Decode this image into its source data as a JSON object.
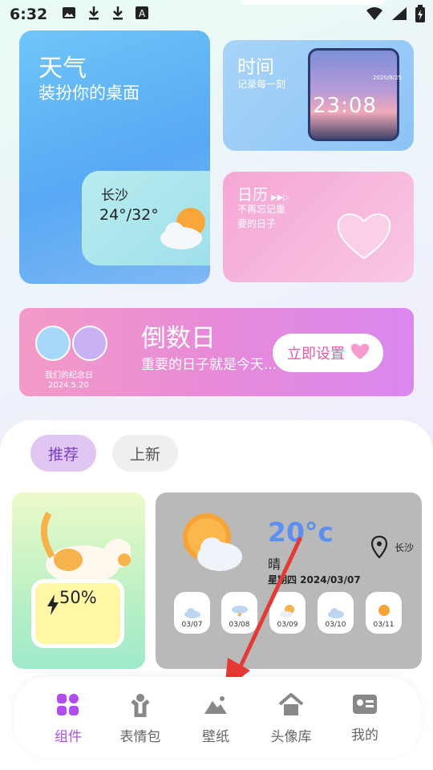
{
  "status_bar": {
    "time": "6:32"
  },
  "weather_card": {
    "title": "天气",
    "subtitle": "装扮你的桌面",
    "city": "长沙",
    "temp_range": "24°/32°"
  },
  "time_card": {
    "title": "时间",
    "subtitle": "记录每一刻",
    "clock": "23:08",
    "photo_date": "2020/8/25"
  },
  "calendar_card": {
    "title": "日历",
    "line1": "不再忘记重",
    "line2": "要的日子"
  },
  "countdown": {
    "title": "倒数日",
    "subtitle": "重要的日子就是今天...",
    "button": "立即设置",
    "caption": "我们的纪念日",
    "date": "2024.5.20"
  },
  "tabs": [
    {
      "label": "推荐"
    },
    {
      "label": "上新"
    }
  ],
  "battery_widget": {
    "percent": "50%",
    "level": 0.5
  },
  "weather_widget": {
    "temperature": "20°c",
    "condition": "晴",
    "date_line": "星期四 2024/03/07",
    "city": "长沙",
    "forecast": [
      {
        "date": "03/07",
        "icon": "cloud-icon"
      },
      {
        "date": "03/08",
        "icon": "thunder-icon"
      },
      {
        "date": "03/09",
        "icon": "sun-cloud-icon"
      },
      {
        "date": "03/10",
        "icon": "cloud-icon"
      },
      {
        "date": "03/11",
        "icon": "sun-icon"
      }
    ]
  },
  "nav": [
    {
      "label": "组件",
      "icon": "widgets-icon",
      "active": true
    },
    {
      "label": "表情包",
      "icon": "person-icon",
      "active": false
    },
    {
      "label": "壁纸",
      "icon": "landscape-icon",
      "active": false
    },
    {
      "label": "头像库",
      "icon": "home-icon",
      "active": false
    },
    {
      "label": "我的",
      "icon": "profile-card-icon",
      "active": false
    }
  ],
  "colors": {
    "accent": "#b14cf0",
    "arrow": "#e53935"
  }
}
